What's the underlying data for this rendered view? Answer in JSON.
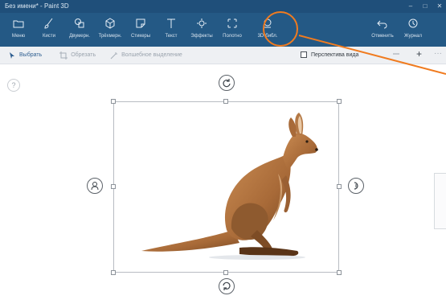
{
  "window": {
    "title": "Без имени* - Paint 3D"
  },
  "ribbon": {
    "items": [
      {
        "label": "Меню",
        "icon": "folder-icon"
      },
      {
        "label": "Кисти",
        "icon": "brush-icon"
      },
      {
        "label": "Двумерн.",
        "icon": "2d-shapes-icon"
      },
      {
        "label": "Трёхмерн.",
        "icon": "3d-shapes-icon"
      },
      {
        "label": "Стикеры",
        "icon": "sticker-icon"
      },
      {
        "label": "Текст",
        "icon": "text-icon"
      },
      {
        "label": "Эффекты",
        "icon": "effects-icon"
      },
      {
        "label": "Полотно",
        "icon": "canvas-icon"
      },
      {
        "label": "3D-библ.",
        "icon": "3d-library-icon"
      }
    ],
    "right_items": [
      {
        "label": "Отменить",
        "icon": "undo-icon"
      },
      {
        "label": "Журнал",
        "icon": "history-icon"
      }
    ]
  },
  "toolbar": {
    "select_label": "Выбрать",
    "crop_label": "Обрезать",
    "magic_label": "Волшебное выделение",
    "perspective_label": "Перспектива вида"
  },
  "annotation": {
    "color": "#f07b1f"
  }
}
